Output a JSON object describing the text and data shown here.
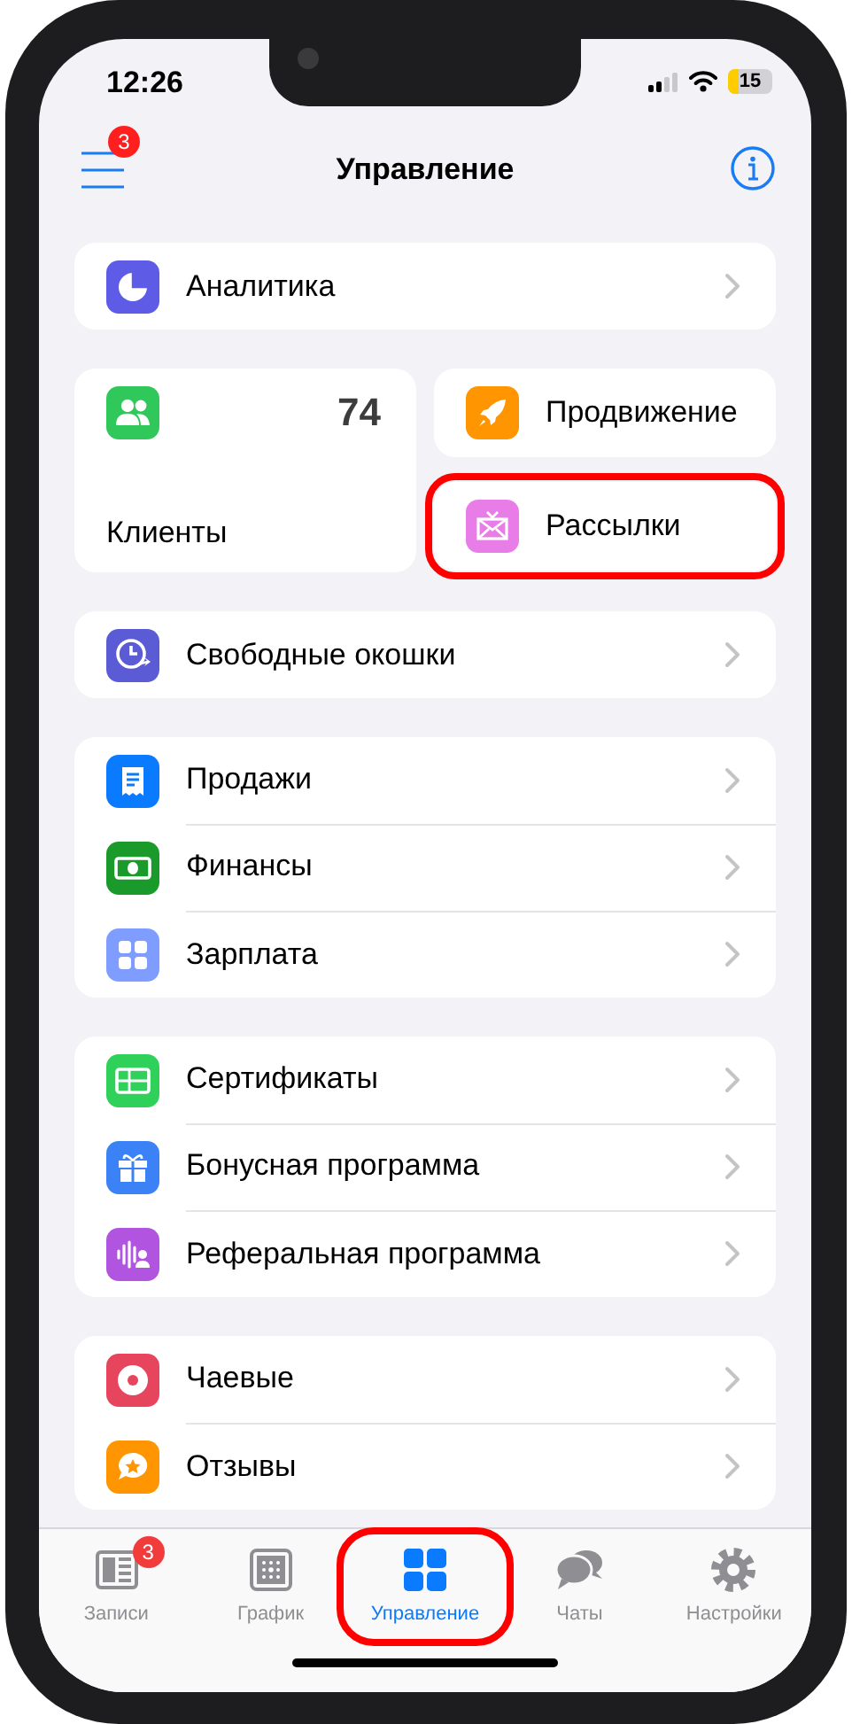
{
  "status_bar": {
    "time": "12:26",
    "battery": "15"
  },
  "header": {
    "title": "Управление",
    "menu_badge": "3"
  },
  "sections": [
    {
      "kind": "list",
      "items": [
        {
          "label": "Аналитика"
        }
      ]
    },
    {
      "kind": "tiles",
      "large": {
        "label": "Клиенты",
        "count": "74"
      },
      "small": [
        {
          "label": "Продвижение",
          "highlighted": false
        },
        {
          "label": "Рассылки",
          "highlighted": true
        }
      ]
    },
    {
      "kind": "list",
      "items": [
        {
          "label": "Свободные окошки"
        }
      ]
    },
    {
      "kind": "list",
      "items": [
        {
          "label": "Продажи"
        },
        {
          "label": "Финансы"
        },
        {
          "label": "Зарплата"
        }
      ]
    },
    {
      "kind": "list",
      "items": [
        {
          "label": "Сертификаты"
        },
        {
          "label": "Бонусная программа"
        },
        {
          "label": "Реферальная программа"
        }
      ]
    },
    {
      "kind": "list",
      "items": [
        {
          "label": "Чаевые"
        },
        {
          "label": "Отзывы"
        }
      ]
    }
  ],
  "tab_bar": [
    {
      "label": "Записи",
      "selected": false,
      "highlighted": false,
      "badge": "3"
    },
    {
      "label": "График",
      "selected": false,
      "highlighted": false
    },
    {
      "label": "Управление",
      "selected": true,
      "highlighted": true
    },
    {
      "label": "Чаты",
      "selected": false,
      "highlighted": false
    },
    {
      "label": "Настройки",
      "selected": false,
      "highlighted": false
    }
  ]
}
